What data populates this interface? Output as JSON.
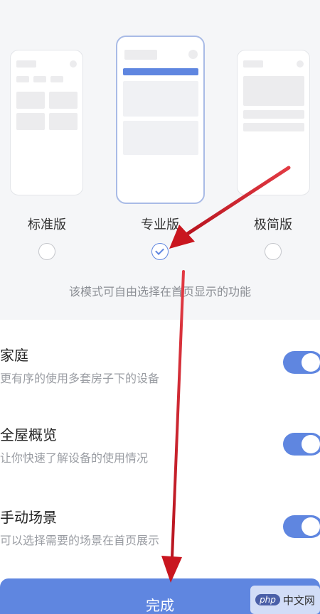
{
  "modes": [
    {
      "label": "标准版",
      "selected": false
    },
    {
      "label": "专业版",
      "selected": true
    },
    {
      "label": "极简版",
      "selected": false
    }
  ],
  "hint": "该模式可自由选择在首页显示的功能",
  "features": [
    {
      "title": "家庭",
      "desc": "更有序的使用多套房子下的设备",
      "enabled": true
    },
    {
      "title": "全屋概览",
      "desc": "让你快速了解设备的使用情况",
      "enabled": true
    },
    {
      "title": "手动场景",
      "desc": "可以选择需要的场景在首页展示",
      "enabled": true
    }
  ],
  "done_label": "完成",
  "watermark": {
    "badge": "php",
    "text": "中文网"
  },
  "colors": {
    "accent": "#5f86e0",
    "arrow": "#d9202c",
    "background": "#f5f6f8"
  },
  "icons": {
    "check": "check-icon",
    "arrow": "red-arrow-annotation"
  }
}
